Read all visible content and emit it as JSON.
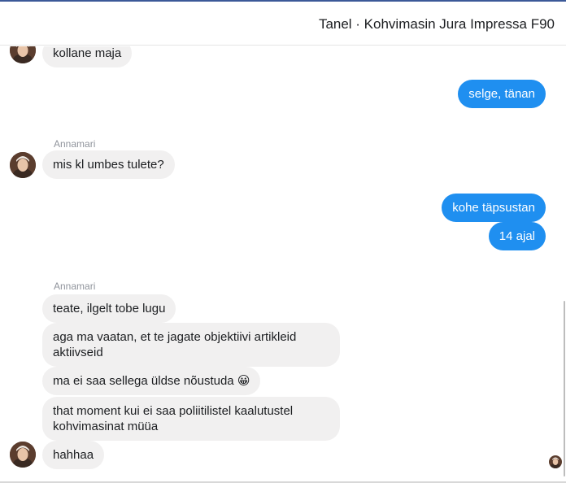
{
  "header": {
    "title": "Tanel · Kohvimasin Jura Impressa F90"
  },
  "messages": {
    "m1": "kollane maja",
    "m2": "selge, tänan",
    "sender1": "Annamari",
    "m3": "mis kl umbes tulete?",
    "m4": "kohe täpsustan",
    "m5": "14 ajal",
    "sender2": "Annamari",
    "m6": "teate, ilgelt tobe lugu",
    "m7": "aga ma vaatan, et te jagate objektiivi artikleid aktiivseid",
    "m8": "ma ei saa sellega üldse nõustuda 😀",
    "m9": "that moment kui ei saa poliitilistel kaalutustel kohvimasinat müüa",
    "m10": "hahhaa"
  },
  "colors": {
    "outgoing_bubble": "#1f8ff0",
    "incoming_bubble": "#f1f0f0",
    "header_accent": "#3b5998"
  }
}
